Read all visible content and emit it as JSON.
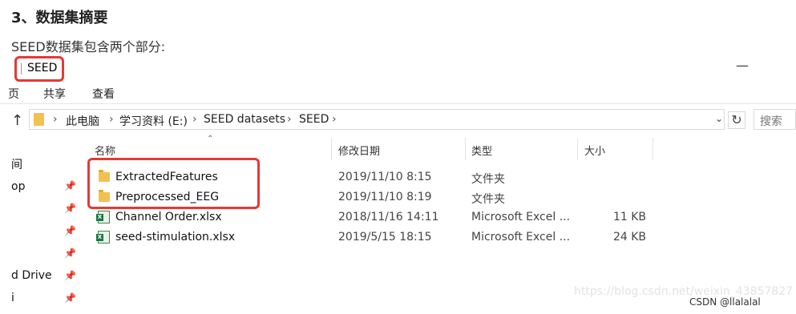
{
  "article": {
    "heading": "3、数据集摘要",
    "intro": "SEED数据集包含两个部分:"
  },
  "window": {
    "title": "SEED",
    "minimize_glyph": "—"
  },
  "ribbon": {
    "tabs": [
      "页",
      "共享",
      "查看"
    ]
  },
  "address_bar": {
    "up_glyph": "↑",
    "separator": "›",
    "crumbs": [
      "此电脑",
      "学习资料 (E:)",
      "SEED datasets",
      "SEED"
    ],
    "dropdown_glyph": "⌄",
    "refresh_glyph": "↻",
    "search_placeholder": "搜索"
  },
  "nav_pane": {
    "items": [
      {
        "label": "间",
        "pinned": false
      },
      {
        "label": "op",
        "pinned": true
      },
      {
        "label": "",
        "pinned": true
      },
      {
        "label": "",
        "pinned": true
      },
      {
        "label": "",
        "pinned": true
      },
      {
        "label": "d Drive",
        "pinned": true
      },
      {
        "label": "i",
        "pinned": true
      }
    ],
    "pin_glyph": "📌"
  },
  "file_list": {
    "sort_glyph": "⌃",
    "columns": {
      "name": "名称",
      "date": "修改日期",
      "type": "类型",
      "size": "大小"
    },
    "rows": [
      {
        "name": "ExtractedFeatures",
        "date": "2019/11/10 8:15",
        "type": "文件夹",
        "size": "",
        "icon": "folder-icon"
      },
      {
        "name": "Preprocessed_EEG",
        "date": "2019/11/10 8:19",
        "type": "文件夹",
        "size": "",
        "icon": "folder-icon"
      },
      {
        "name": "Channel Order.xlsx",
        "date": "2018/11/16 14:11",
        "type": "Microsoft Excel ...",
        "size": "11 KB",
        "icon": "excel-icon"
      },
      {
        "name": "seed-stimulation.xlsx",
        "date": "2019/5/15 18:15",
        "type": "Microsoft Excel ...",
        "size": "24 KB",
        "icon": "excel-icon"
      }
    ]
  },
  "watermark": "https://blog.csdn.net/weixin_43857827",
  "credit": "CSDN @llalalal",
  "colors": {
    "highlight": "#e53935",
    "folder": "#f2c14e",
    "excel": "#217346"
  }
}
